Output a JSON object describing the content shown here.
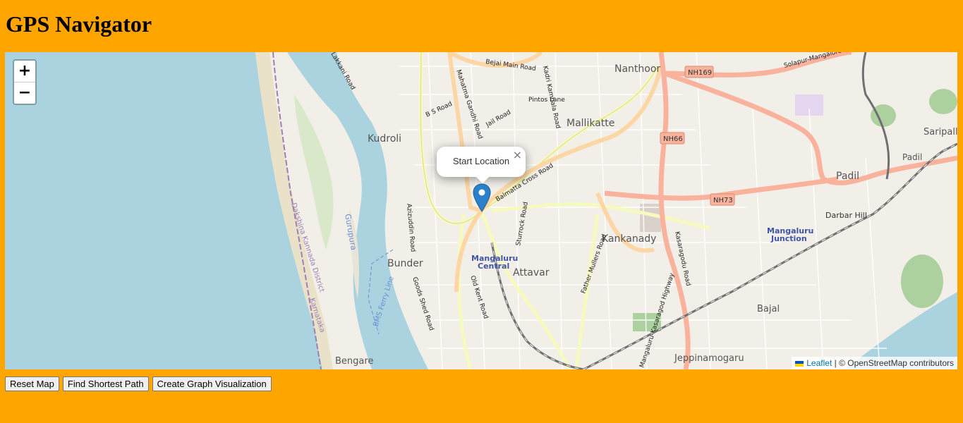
{
  "page": {
    "title": "GPS Navigator"
  },
  "map": {
    "zoom_in_label": "+",
    "zoom_out_label": "−",
    "popup": {
      "text": "Start Location",
      "close": "×"
    },
    "attribution": {
      "leaflet": "Leaflet",
      "separator": " | © OpenStreetMap contributors"
    },
    "labels": {
      "nanthoor": "Nanthoor",
      "mallikatte": "Mallikatte",
      "kudroli": "Kudroli",
      "padil": "Padil",
      "padil_station": "Padil",
      "saripalla": "Saripalla",
      "bunder": "Bunder",
      "kankanady": "Kankanady",
      "attavar": "Attavar",
      "mangaluru_central_1": "Mangaluru",
      "mangaluru_central_2": "Central",
      "mangaluru_junction_1": "Mangaluru",
      "mangaluru_junction_2": "Junction",
      "darbar_hill": "Darbar Hill",
      "bajal": "Bajal",
      "bengare": "Bengare",
      "jeppinamogaru": "Jeppinamogaru",
      "gurupura": "Gurupura",
      "bms_ferry": "BMS Ferry Line",
      "dk_district": "Dakshina Kannada District",
      "karnataka": "Karnataka",
      "nh169": "NH169",
      "nh66": "NH66",
      "nh73": "NH73",
      "solapur": "Solapur-Mangalore",
      "bejai": "Bejai Main Road",
      "kadri": "Kadri Kambala Road",
      "pintos": "Pintos Lane",
      "bs_road": "B S Road",
      "mg_road": "Mahatma Gandhi Road",
      "jail_road": "Jail Road",
      "balmatta": "Balmatta Cross Road",
      "azizuddin": "Azizuddin Road",
      "sturrock": "Sturrock Road",
      "father_mullers": "Father Mullers Road",
      "kasaragodu": "Kasaragodu Road",
      "goods_shed": "Goods Shed Road",
      "old_kent": "Old Kent Road",
      "highway": "Mangaluru-Kasaragod Highway",
      "lakkani": "Lakkani Road"
    }
  },
  "controls": {
    "reset": "Reset Map",
    "shortest": "Find Shortest Path",
    "graph": "Create Graph Visualization"
  },
  "colors": {
    "page_bg": "#ffa500",
    "water": "#aad3df",
    "land": "#f2efe9",
    "primary_road": "#f9b29c",
    "secondary_road": "#fcd6a4",
    "tertiary_road": "#f7fabf",
    "marker": "#2a81cb"
  }
}
